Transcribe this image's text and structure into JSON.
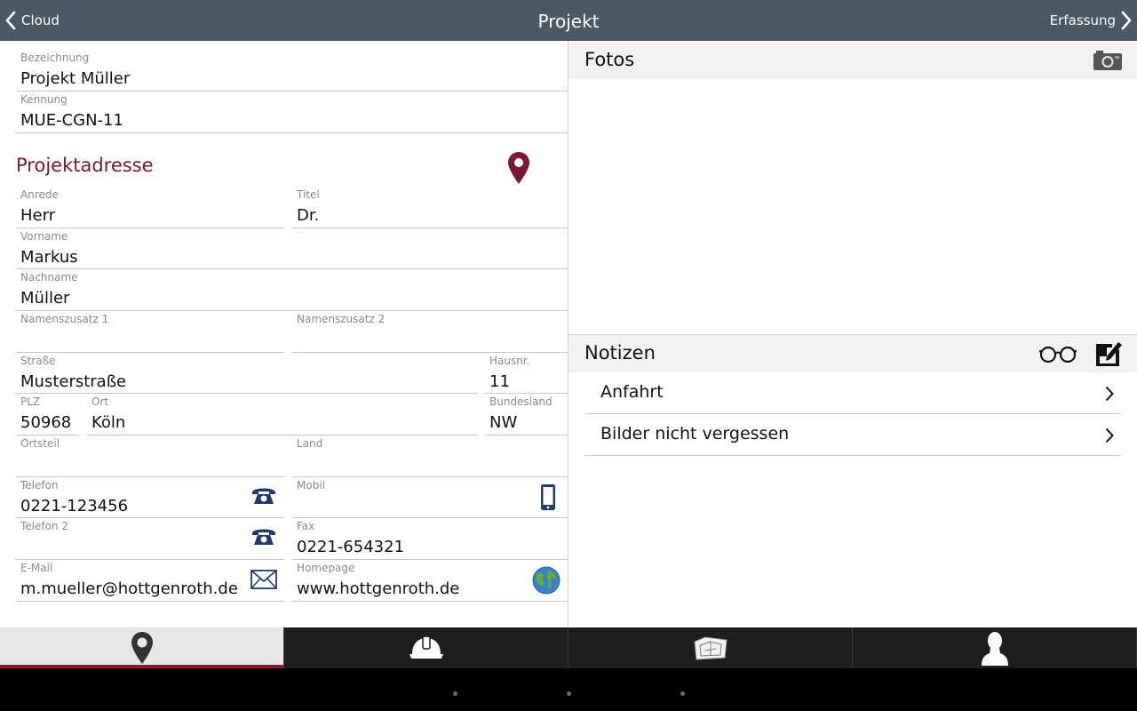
{
  "header": {
    "back_label": "Cloud",
    "title": "Projekt",
    "forward_label": "Erfassung"
  },
  "project": {
    "bezeichnung": {
      "label": "Bezeichnung",
      "value": "Projekt Müller"
    },
    "kennung": {
      "label": "Kennung",
      "value": "MUE-CGN-11"
    }
  },
  "address": {
    "section_title": "Projektadresse",
    "anrede": {
      "label": "Anrede",
      "value": "Herr"
    },
    "titel": {
      "label": "Titel",
      "value": "Dr."
    },
    "vorname": {
      "label": "Vorname",
      "value": "Markus"
    },
    "nachname": {
      "label": "Nachname",
      "value": "Müller"
    },
    "namenszusatz1": {
      "label": "Namenszusatz 1",
      "value": ""
    },
    "namenszusatz2": {
      "label": "Namenszusatz 2",
      "value": ""
    },
    "strasse": {
      "label": "Straße",
      "value": "Musterstraße"
    },
    "hausnr": {
      "label": "Hausnr.",
      "value": "11"
    },
    "plz": {
      "label": "PLZ",
      "value": "50968"
    },
    "ort": {
      "label": "Ort",
      "value": "Köln"
    },
    "bundesland": {
      "label": "Bundesland",
      "value": "NW"
    },
    "ortsteil": {
      "label": "Ortsteil",
      "value": ""
    },
    "land": {
      "label": "Land",
      "value": ""
    },
    "telefon": {
      "label": "Telefon",
      "value": "0221-123456"
    },
    "mobil": {
      "label": "Mobil",
      "value": ""
    },
    "telefon2": {
      "label": "Telefon 2",
      "value": ""
    },
    "fax": {
      "label": "Fax",
      "value": "0221-654321"
    },
    "email": {
      "label": "E-Mail",
      "value": "m.mueller@hottgenroth.de"
    },
    "homepage": {
      "label": "Homepage",
      "value": "www.hottgenroth.de"
    }
  },
  "photos": {
    "title": "Fotos"
  },
  "notes": {
    "title": "Notizen",
    "items": [
      {
        "label": "Anfahrt"
      },
      {
        "label": "Bilder nicht vergessen"
      }
    ]
  },
  "tabs": [
    {
      "icon": "location-pin-icon",
      "active": true
    },
    {
      "icon": "hard-hat-icon",
      "active": false
    },
    {
      "icon": "building-plan-icon",
      "active": false
    },
    {
      "icon": "person-icon",
      "active": false
    }
  ],
  "colors": {
    "header_bg": "#4a5966",
    "accent": "#7d1630",
    "icon_blue": "#1f3c6b"
  }
}
